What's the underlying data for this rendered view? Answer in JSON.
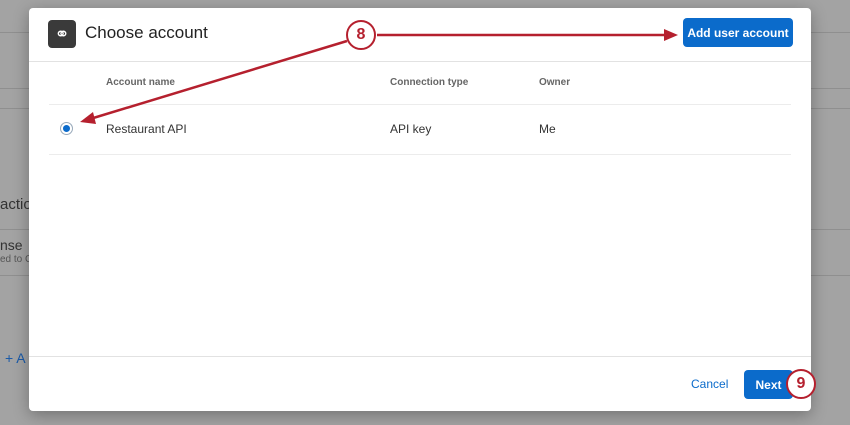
{
  "background": {
    "fragments": [
      "actio",
      "nse",
      "ed to C",
      "+ A"
    ]
  },
  "dialog": {
    "title": "Choose account",
    "add_button": "Add user account",
    "columns": [
      "Account name",
      "Connection type",
      "Owner"
    ],
    "rows": [
      {
        "name": "Restaurant API",
        "connection": "API key",
        "owner": "Me",
        "selected": true
      }
    ],
    "cancel": "Cancel",
    "next": "Next"
  },
  "annotations": [
    "8",
    "9"
  ],
  "colors": {
    "accent": "#0b6bcb",
    "annotation": "#b5202e"
  }
}
